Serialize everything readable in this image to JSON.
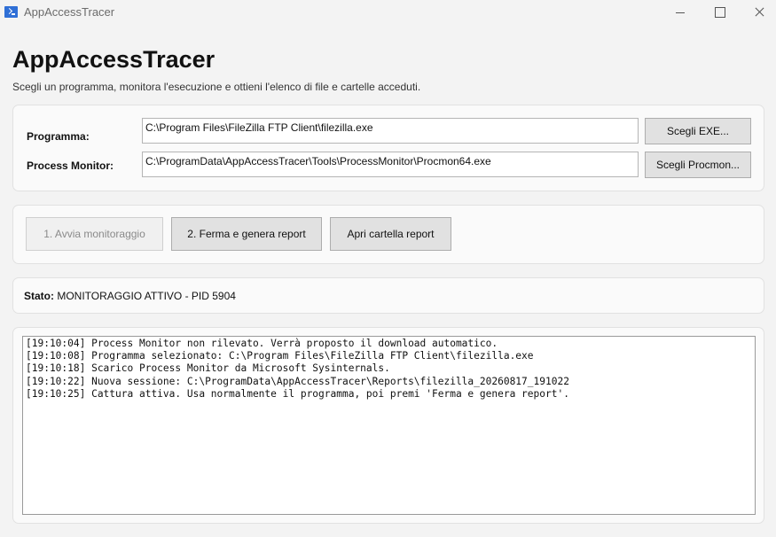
{
  "window": {
    "title": "AppAccessTracer"
  },
  "header": {
    "title": "AppAccessTracer",
    "subtitle": "Scegli un programma, monitora l'esecuzione e ottieni l'elenco di file e cartelle acceduti."
  },
  "paths": {
    "program_label": "Programma:",
    "program_value": "C:\\Program Files\\FileZilla FTP Client\\filezilla.exe",
    "program_button": "Scegli EXE...",
    "procmon_label": "Process Monitor:",
    "procmon_value": "C:\\ProgramData\\AppAccessTracer\\Tools\\ProcessMonitor\\Procmon64.exe",
    "procmon_button": "Scegli Procmon..."
  },
  "actions": {
    "start_label": "1. Avvia monitoraggio",
    "stop_label": "2. Ferma e genera report",
    "open_label": "Apri cartella report"
  },
  "status": {
    "label": "Stato:",
    "value": "MONITORAGGIO ATTIVO - PID 5904"
  },
  "log": {
    "lines": [
      "[19:10:04] Process Monitor non rilevato. Verrà proposto il download automatico.",
      "[19:10:08] Programma selezionato: C:\\Program Files\\FileZilla FTP Client\\filezilla.exe",
      "[19:10:18] Scarico Process Monitor da Microsoft Sysinternals.",
      "[19:10:22] Nuova sessione: C:\\ProgramData\\AppAccessTracer\\Reports\\filezilla_20260817_191022",
      "[19:10:25] Cattura attiva. Usa normalmente il programma, poi premi 'Ferma e genera report'."
    ]
  },
  "icons": {
    "app": "powershell-icon",
    "minimize": "minimize-icon",
    "maximize": "maximize-icon",
    "close": "close-icon"
  },
  "colors": {
    "accent": "#2f6fd6",
    "background": "#f3f3f3"
  }
}
